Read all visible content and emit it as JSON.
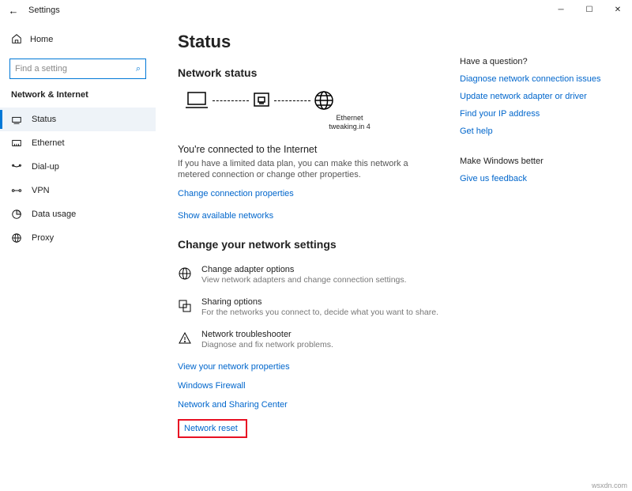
{
  "window": {
    "title": "Settings"
  },
  "sidebar": {
    "home": "Home",
    "search_placeholder": "Find a setting",
    "section": "Network & Internet",
    "items": [
      {
        "label": "Status"
      },
      {
        "label": "Ethernet"
      },
      {
        "label": "Dial-up"
      },
      {
        "label": "VPN"
      },
      {
        "label": "Data usage"
      },
      {
        "label": "Proxy"
      }
    ]
  },
  "main": {
    "h1": "Status",
    "h2": "Network status",
    "diagram": {
      "iface": "Ethernet",
      "network": "tweaking.in 4"
    },
    "connected_title": "You're connected to the Internet",
    "connected_desc": "If you have a limited data plan, you can make this network a metered connection or change other properties.",
    "link_change_props": "Change connection properties",
    "link_show_networks": "Show available networks",
    "h2b": "Change your network settings",
    "opts": [
      {
        "t": "Change adapter options",
        "d": "View network adapters and change connection settings."
      },
      {
        "t": "Sharing options",
        "d": "For the networks you connect to, decide what you want to share."
      },
      {
        "t": "Network troubleshooter",
        "d": "Diagnose and fix network problems."
      }
    ],
    "links_bottom": [
      "View your network properties",
      "Windows Firewall",
      "Network and Sharing Center"
    ],
    "link_reset": "Network reset"
  },
  "right": {
    "q_head": "Have a question?",
    "q_links": [
      "Diagnose network connection issues",
      "Update network adapter or driver",
      "Find your IP address",
      "Get help"
    ],
    "fb_head": "Make Windows better",
    "fb_link": "Give us feedback"
  },
  "watermark": "wsxdn.com"
}
